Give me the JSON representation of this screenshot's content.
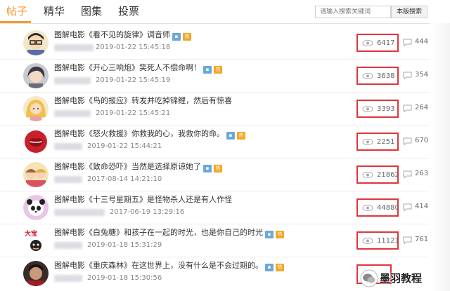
{
  "tabs": [
    {
      "label": "帖子",
      "active": true
    },
    {
      "label": "精华",
      "active": false
    },
    {
      "label": "图集",
      "active": false
    },
    {
      "label": "投票",
      "active": false
    }
  ],
  "search": {
    "placeholder": "请输入搜索关键词",
    "button_label": "本版搜索"
  },
  "colors": {
    "accent": "#f49b36",
    "highlight_box": "#e0353d"
  },
  "posts": [
    {
      "title": "图解电影《看不见的旋律》调音师",
      "time": "2019-01-22 15:45:18",
      "views": "6417",
      "replies": "444",
      "avatar": "cartoon-guy-icon"
    },
    {
      "title": "图解电影《开心三响炮》笑死人不偿命啊！",
      "time": "2019-01-22 15:45:19",
      "views": "3638",
      "replies": "354",
      "avatar": "cartoon-girl-icon"
    },
    {
      "title": "图解电影《鸟的报应》转发并吃掉锦鲤，然后有惊喜",
      "time": "2019-01-22 15:45:21",
      "views": "3393",
      "replies": "264",
      "avatar": "cartoon-blonde-icon"
    },
    {
      "title": "图解电影《怒火救援》你救我的心，我救你的命。",
      "time": "2019-01-22 15:44:21",
      "views": "2251",
      "replies": "670",
      "avatar": "red-lips-icon"
    },
    {
      "title": "图解电影《致命恐吓》当然是选择原谅她了",
      "time": "2017-08-14 14:21:10",
      "views": "21862",
      "replies": "263",
      "avatar": "anime-group-icon"
    },
    {
      "title": "图解电影《十三号星期五》是怪物杀人还是有人作怪",
      "time": "2017-06-19 13:29:16",
      "views": "44880",
      "replies": "414",
      "avatar": "panda-girl-icon"
    },
    {
      "title": "图解电影《白兔糖》和孩子在一起的时光，也是你自己的时光",
      "time": "2019-01-18 15:31:29",
      "views": "11121",
      "replies": "761",
      "avatar": "dabao-logo-icon"
    },
    {
      "title": "图解电影《重庆森林》在这世界上，没有什么是不会过期的。",
      "time": "2019-01-18 15:30:56",
      "views": "",
      "replies": "",
      "avatar": "dark-portrait-icon"
    }
  ],
  "watermark": {
    "text": "墨羽教程"
  }
}
